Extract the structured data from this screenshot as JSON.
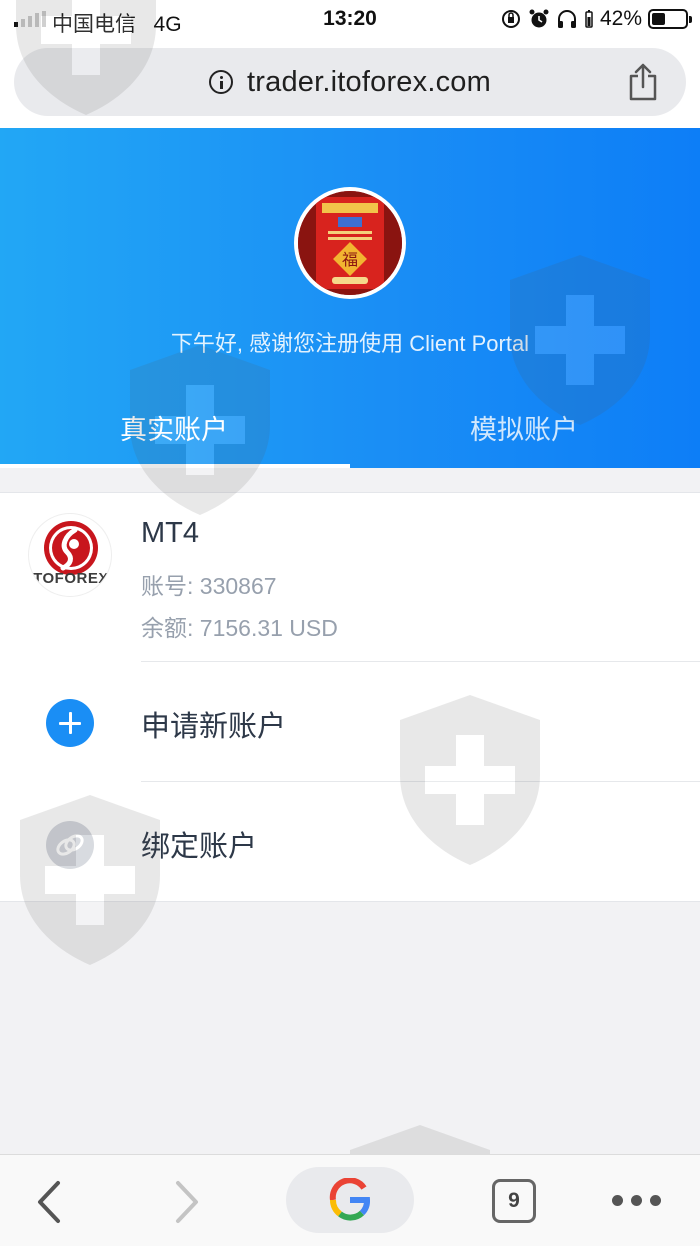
{
  "status_bar": {
    "carrier": "中国电信",
    "network": "4G",
    "time": "13:20",
    "battery": "42%",
    "battery_level": 0.42
  },
  "browser": {
    "url": "trader.itoforex.com",
    "tab_count": "9"
  },
  "header": {
    "greeting": "下午好, 感谢您注册使用 Client Portal",
    "tabs": [
      {
        "label": "真实账户",
        "active": true
      },
      {
        "label": "模拟账户",
        "active": false
      }
    ]
  },
  "account": {
    "logo_text": "TOFOREX",
    "name": "MT4",
    "number": "账号: 330867",
    "balance": "余额: 7156.31 USD"
  },
  "actions": {
    "new_account": "申请新账户",
    "bind_account": "绑定账户"
  },
  "colors": {
    "primary_blue": "#1a8ef5",
    "logo_red": "#c8161d"
  }
}
